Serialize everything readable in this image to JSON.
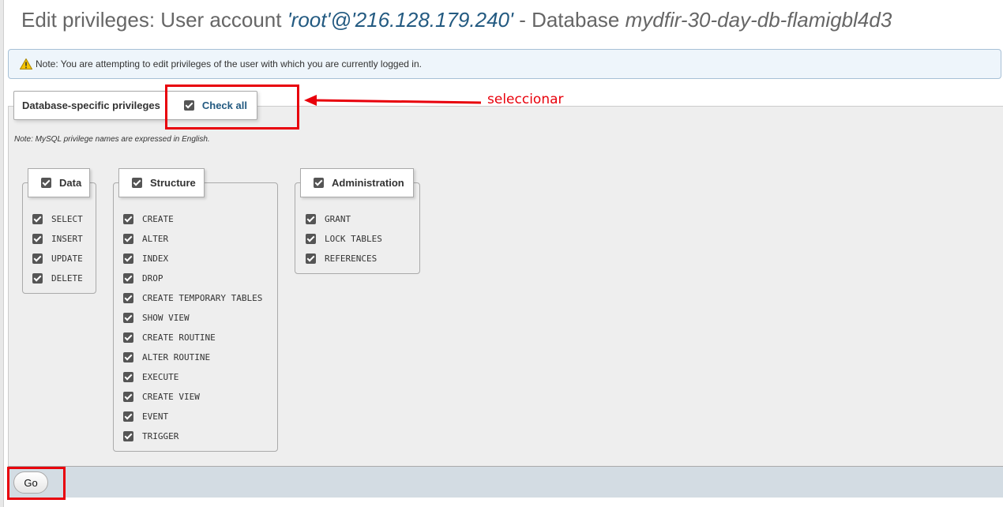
{
  "title": {
    "prefix": "Edit privileges: User account ",
    "user": "'root'@'216.128.179.240'",
    "middle": " - Database ",
    "database": "mydfir-30-day-db-flamigbl4d3"
  },
  "notice": {
    "icon": "warning-icon",
    "text": "Note: You are attempting to edit privileges of the user with which you are currently logged in."
  },
  "privileges": {
    "legend": "Database-specific privileges",
    "check_all_label": "Check all",
    "check_all_checked": true,
    "note": "Note: MySQL privilege names are expressed in English.",
    "groups": [
      {
        "name": "Data",
        "checked": true,
        "items": [
          "SELECT",
          "INSERT",
          "UPDATE",
          "DELETE"
        ]
      },
      {
        "name": "Structure",
        "checked": true,
        "items": [
          "CREATE",
          "ALTER",
          "INDEX",
          "DROP",
          "CREATE TEMPORARY TABLES",
          "SHOW VIEW",
          "CREATE ROUTINE",
          "ALTER ROUTINE",
          "EXECUTE",
          "CREATE VIEW",
          "EVENT",
          "TRIGGER"
        ]
      },
      {
        "name": "Administration",
        "checked": true,
        "items": [
          "GRANT",
          "LOCK TABLES",
          "REFERENCES"
        ]
      }
    ]
  },
  "go_button": "Go",
  "annotation": {
    "text": "seleccionar",
    "color": "#e8000b"
  }
}
